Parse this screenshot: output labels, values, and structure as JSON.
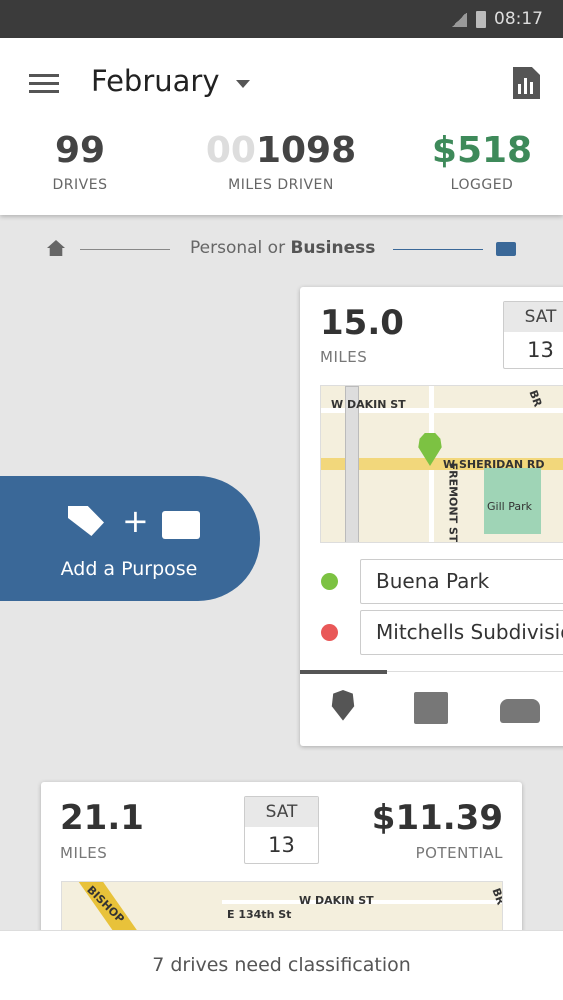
{
  "status_bar": {
    "time": "08:17"
  },
  "header": {
    "month": "February",
    "stats": [
      {
        "value_dim": "",
        "value": "99",
        "label": "DRIVES"
      },
      {
        "value_dim": "00",
        "value": "1098",
        "label": "MILES DRIVEN"
      },
      {
        "value_dim": "",
        "value": "$518",
        "label": "LOGGED"
      }
    ]
  },
  "hint": {
    "prefix": "Personal or ",
    "bold": "Business"
  },
  "colors": {
    "accent": "#3a6898",
    "logged_green": "#3e8a5a",
    "start": "#7cc242",
    "end": "#e95858"
  },
  "purpose": {
    "label": "Add a Purpose",
    "plus": "+"
  },
  "drive1": {
    "miles": "15.0",
    "miles_label": "MILES",
    "day": "SAT",
    "date": "13",
    "start": "Buena Park",
    "end": "Mitchells Subdivision",
    "map_labels": [
      "W DAKIN ST",
      "W SHERIDAN RD",
      "FREMONT ST",
      "Gill Park",
      "BR"
    ]
  },
  "drive2": {
    "miles": "21.1",
    "miles_label": "MILES",
    "day": "SAT",
    "date": "13",
    "value": "$11.39",
    "value_label": "POTENTIAL",
    "map_labels": [
      "BISHOP",
      "W DAKIN ST",
      "E 134th St",
      "BR"
    ]
  },
  "bottom": {
    "text": "7 drives need classification"
  }
}
